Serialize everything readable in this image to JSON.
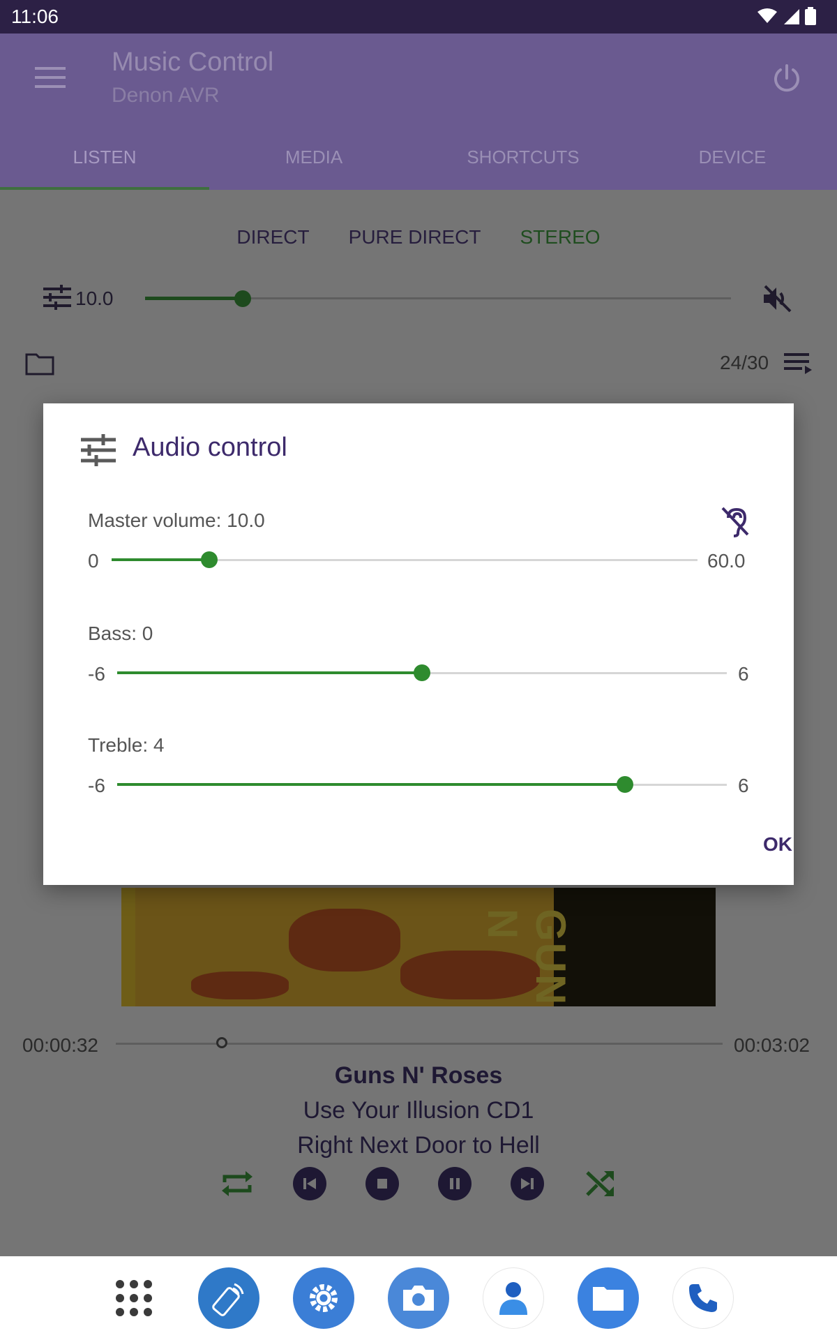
{
  "status_bar": {
    "time": "11:06"
  },
  "app_bar": {
    "title": "Music Control",
    "subtitle": "Denon AVR"
  },
  "tabs": [
    {
      "label": "LISTEN",
      "active": true
    },
    {
      "label": "MEDIA",
      "active": false
    },
    {
      "label": "SHORTCUTS",
      "active": false
    },
    {
      "label": "DEVICE",
      "active": false
    }
  ],
  "listen": {
    "modes": [
      "DIRECT",
      "PURE DIRECT",
      "STEREO"
    ],
    "volume_value": "10.0",
    "queue_position": "24/30"
  },
  "player": {
    "time_elapsed": "00:00:32",
    "time_total": "00:03:02",
    "progress": 0.175,
    "artist": "Guns N' Roses",
    "album": "Use Your Illusion CD1",
    "title": "Right Next Door to Hell",
    "album_art_text": "GUNS N"
  },
  "dialog": {
    "title": "Audio control",
    "master": {
      "label": "Master volume: 10.0",
      "min": "0",
      "max": "60.0",
      "value": 10,
      "range": [
        0,
        60
      ]
    },
    "bass": {
      "label": "Bass: 0",
      "min": "-6",
      "max": "6",
      "value": 0,
      "range": [
        -6,
        6
      ]
    },
    "treble": {
      "label": "Treble: 4",
      "min": "-6",
      "max": "6",
      "value": 4,
      "range": [
        -6,
        6
      ]
    },
    "ok_label": "OK"
  },
  "colors": {
    "accent_green": "#2e8b2e",
    "primary": "#6a5a90",
    "title": "#3d2a6b"
  },
  "dock": [
    "apps-grid-icon",
    "remote-app-icon",
    "settings-app-icon",
    "camera-app-icon",
    "contacts-app-icon",
    "files-app-icon",
    "phone-app-icon"
  ]
}
